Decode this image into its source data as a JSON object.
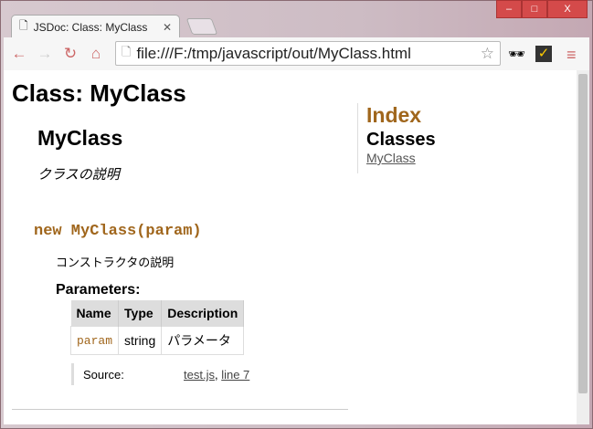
{
  "browser": {
    "tab_title": "JSDoc: Class: MyClass",
    "url": "file:///F:/tmp/javascript/out/MyClass.html"
  },
  "page": {
    "title": "Class: MyClass",
    "class_name": "MyClass",
    "class_desc": "クラスの説明",
    "constructor": "new MyClass(param)",
    "constructor_desc": "コンストラクタの説明",
    "params_label": "Parameters:",
    "table": {
      "headers": [
        "Name",
        "Type",
        "Description"
      ],
      "rows": [
        [
          "param",
          "string",
          "パラメータ"
        ]
      ]
    },
    "source_label": "Source:",
    "source_file": "test.js",
    "source_sep": ", ",
    "source_line": "line 7"
  },
  "nav": {
    "index": "Index",
    "classes": "Classes",
    "items": [
      "MyClass"
    ]
  }
}
